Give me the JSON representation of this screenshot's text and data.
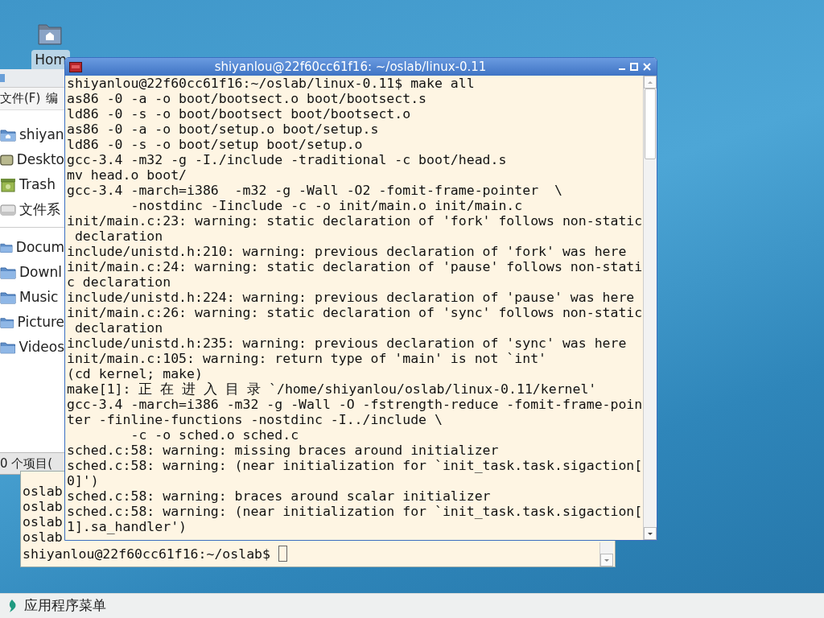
{
  "desktop_icons": [
    {
      "label": "Hom",
      "selected": true
    }
  ],
  "file_manager": {
    "menu": [
      "文件(F)",
      "编"
    ],
    "places": [
      {
        "label": "shiyan",
        "kind": "home"
      },
      {
        "label": "Deskto",
        "kind": "desktop"
      },
      {
        "label": "Trash",
        "kind": "trash"
      },
      {
        "label": "文件系",
        "kind": "drive"
      }
    ],
    "bookmarks": [
      {
        "label": "Docum",
        "kind": "folder"
      },
      {
        "label": "Downl",
        "kind": "folder"
      },
      {
        "label": "Music",
        "kind": "folder"
      },
      {
        "label": "Picture",
        "kind": "folder"
      },
      {
        "label": "Videos",
        "kind": "folder"
      }
    ],
    "status": "0 个项目("
  },
  "back_terminal": {
    "lines": [
      "oslab",
      "oslab",
      "oslab",
      "oslab"
    ],
    "prompt": "shiyanlou@22f60cc61f16:~/oslab$"
  },
  "terminal": {
    "title": "shiyanlou@22f60cc61f16: ~/oslab/linux-0.11",
    "lines": [
      "shiyanlou@22f60cc61f16:~/oslab/linux-0.11$ make all",
      "as86 -0 -a -o boot/bootsect.o boot/bootsect.s",
      "ld86 -0 -s -o boot/bootsect boot/bootsect.o",
      "as86 -0 -a -o boot/setup.o boot/setup.s",
      "ld86 -0 -s -o boot/setup boot/setup.o",
      "gcc-3.4 -m32 -g -I./include -traditional -c boot/head.s",
      "mv head.o boot/",
      "gcc-3.4 -march=i386  -m32 -g -Wall -O2 -fomit-frame-pointer  \\",
      "        -nostdinc -Iinclude -c -o init/main.o init/main.c",
      "init/main.c:23: warning: static declaration of 'fork' follows non-static",
      " declaration",
      "include/unistd.h:210: warning: previous declaration of 'fork' was here",
      "init/main.c:24: warning: static declaration of 'pause' follows non-stati",
      "c declaration",
      "include/unistd.h:224: warning: previous declaration of 'pause' was here",
      "init/main.c:26: warning: static declaration of 'sync' follows non-static",
      " declaration",
      "include/unistd.h:235: warning: previous declaration of 'sync' was here",
      "init/main.c:105: warning: return type of 'main' is not `int'",
      "(cd kernel; make)",
      "make[1]: 正 在 进 入 目 录 `/home/shiyanlou/oslab/linux-0.11/kernel'",
      "gcc-3.4 -march=i386 -m32 -g -Wall -O -fstrength-reduce -fomit-frame-poin",
      "ter -finline-functions -nostdinc -I../include \\",
      "        -c -o sched.o sched.c",
      "sched.c:58: warning: missing braces around initializer",
      "sched.c:58: warning: (near initialization for `init_task.task.sigaction[",
      "0]')",
      "sched.c:58: warning: braces around scalar initializer",
      "sched.c:58: warning: (near initialization for `init_task.task.sigaction[",
      "1].sa_handler')"
    ]
  },
  "taskbar": {
    "menu_label": "应用程序菜单"
  }
}
